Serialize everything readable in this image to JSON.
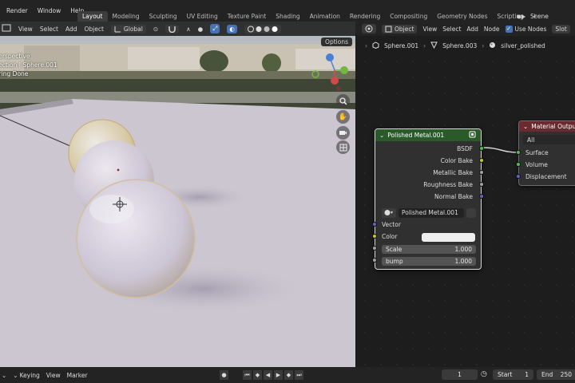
{
  "menus": [
    "Render",
    "Window",
    "Help"
  ],
  "workspace_tabs": [
    {
      "label": "Layout",
      "active": true
    },
    {
      "label": "Modeling",
      "active": false
    },
    {
      "label": "Sculpting",
      "active": false
    },
    {
      "label": "UV Editing",
      "active": false
    },
    {
      "label": "Texture Paint",
      "active": false
    },
    {
      "label": "Shading",
      "active": false
    },
    {
      "label": "Animation",
      "active": false
    },
    {
      "label": "Rendering",
      "active": false
    },
    {
      "label": "Compositing",
      "active": false
    },
    {
      "label": "Geometry Nodes",
      "active": false
    },
    {
      "label": "Scripting",
      "active": false
    }
  ],
  "tab_add": "+",
  "scene": {
    "label": "Scene"
  },
  "viewport": {
    "header": {
      "view": "View",
      "select": "Select",
      "add": "Add",
      "object": "Object",
      "orientation": "Global"
    },
    "options": "Options",
    "overlay_lines": [
      "Perspective",
      "llection | Sphere.001",
      "ering Done"
    ]
  },
  "node_editor": {
    "header": {
      "object": "Object",
      "view": "View",
      "select": "Select",
      "add": "Add",
      "node": "Node",
      "use_nodes": "Use Nodes",
      "slot": "Slot"
    },
    "breadcrumb": [
      "Sphere.001",
      "Sphere.003",
      "silver_polished"
    ],
    "group_node": {
      "title": "Polished Metal.001",
      "outputs": [
        "BSDF",
        "Color Bake",
        "Metallic Bake",
        "Roughness Bake",
        "Normal Bake"
      ],
      "datablock": "Polished Metal.001",
      "inputs": {
        "vector": "Vector",
        "color": "Color"
      },
      "fields": [
        {
          "label": "Scale",
          "value": "1.000"
        },
        {
          "label": "bump",
          "value": "1.000"
        }
      ]
    },
    "output_node": {
      "title": "Material Output",
      "target": "All",
      "inputs": [
        "Surface",
        "Volume",
        "Displacement"
      ]
    },
    "socket_colors": {
      "shader": "#4fc14f",
      "color": "#c7c729",
      "float": "#a1a1a1",
      "vector": "#6363c7"
    }
  },
  "timeline": {
    "keying": "Keying",
    "view": "View",
    "marker": "Marker",
    "current_frame": "1",
    "start_label": "Start",
    "start_value": "1",
    "end_label": "End",
    "end_value": "250"
  }
}
